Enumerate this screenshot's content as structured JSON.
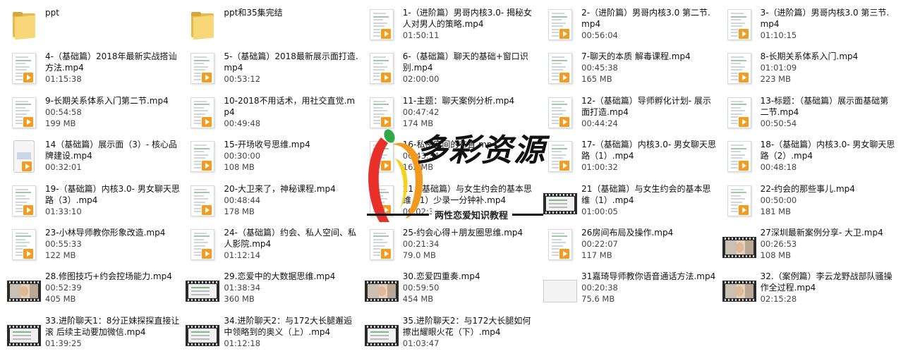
{
  "items": [
    {
      "name": "ppt",
      "line1": "",
      "line2": "",
      "thumb": "folder"
    },
    {
      "name": "ppt和35集完结",
      "line1": "",
      "line2": "",
      "thumb": "folder"
    },
    {
      "name": "1-（进阶篇）男哥内核3.0- 揭秘女人对男人的策略.mp4",
      "line1": "01:50:11",
      "line2": "",
      "thumb": "doc"
    },
    {
      "name": "2-（进阶篇）男哥内核3.0 第二节.mp4",
      "line1": "00:56:04",
      "line2": "",
      "thumb": "doc"
    },
    {
      "name": "3-（进阶篇）男哥内核3.0 第三节.mp4",
      "line1": "01:10:15",
      "line2": "",
      "thumb": "doc"
    },
    {
      "name": "4-（基础篇）2018年最新实战搭讪方法.mp4",
      "line1": "01:15:38",
      "line2": "",
      "thumb": "doc"
    },
    {
      "name": "5-（基础篇）2018最新展示面打造.mp4",
      "line1": "00:53:12",
      "line2": "",
      "thumb": "doc"
    },
    {
      "name": "6-（基础篇）聊天的基础+窗口识别.mp4",
      "line1": "02:00:00",
      "line2": "",
      "thumb": "doc"
    },
    {
      "name": "7-聊天的本质 解毒课程.mp4",
      "line1": "00:45:38",
      "line2": "165 MB",
      "thumb": "doc"
    },
    {
      "name": "8-长期关系体系入门.mp4",
      "line1": "01:01:09",
      "line2": "223 MB",
      "thumb": "doc"
    },
    {
      "name": "9-长期关系体系入门第二节.mp4",
      "line1": "00:54:58",
      "line2": "199 MB",
      "thumb": "doc"
    },
    {
      "name": "10-2018不用话术，用社交直觉.mp4",
      "line1": "00:49:48",
      "line2": "",
      "thumb": "doc"
    },
    {
      "name": "11-主题：聊天案例分析.mp4",
      "line1": "00:47:42",
      "line2": "174 MB",
      "thumb": "doc"
    },
    {
      "name": "12-（基础篇）导师孵化计划- 展示面打造.mp4",
      "line1": "00:44:24",
      "line2": "",
      "thumb": "doc"
    },
    {
      "name": "13-标题：（基础篇）展示面基础第二节.mp4",
      "line1": "00:50:54",
      "line2": "",
      "thumb": "doc"
    },
    {
      "name": "14（基础篇）展示面（3）- 核心品牌建设.mp4",
      "line1": "00:32:01",
      "line2": "",
      "thumb": "phone"
    },
    {
      "name": "15-开场收号思维.mp4",
      "line1": "00:30:00",
      "line2": "108 MB",
      "thumb": "doc"
    },
    {
      "name": "16-私密空间的布置.mp4",
      "line1": "00:43:34",
      "line2": "162 MB",
      "thumb": "doc"
    },
    {
      "name": "17-（基础篇）内核3.0- 男女聊天思路（1）.mp4",
      "line1": "01:00:32",
      "line2": "",
      "thumb": "doc"
    },
    {
      "name": "18-（基础篇）内核3.0- 男女聊天思路（2）.mp4",
      "line1": "00:48:18",
      "line2": "",
      "thumb": "doc"
    },
    {
      "name": "19-（基础篇）内核3.0- 男女聊天思路（3）.mp4",
      "line1": "01:33:10",
      "line2": "",
      "thumb": "doc"
    },
    {
      "name": "20-大卫来了，神秘课程.mp4",
      "line1": "00:48:44",
      "line2": "178 MB",
      "thumb": "doc"
    },
    {
      "name": "21（基础篇）与女生约会的基本思维（1）少录一分钟补.mp4",
      "line1": "00:02:34",
      "line2": "",
      "thumb": "doc"
    },
    {
      "name": "21（基础篇）与女生约会的基本思维（1）.mp4",
      "line1": "01:00:05",
      "line2": "",
      "thumb": "film-screen"
    },
    {
      "name": "22-约会的那些事儿.mp4",
      "line1": "00:50:00",
      "line2": "181 MB",
      "thumb": "doc"
    },
    {
      "name": "23-小林导师教你形象改造.mp4",
      "line1": "00:55:33",
      "line2": "122 MB",
      "thumb": "doc"
    },
    {
      "name": "24-（基础篇）约会、私人空间、私人影院.mp4",
      "line1": "01:12:14",
      "line2": "",
      "thumb": "doc"
    },
    {
      "name": "25-约会心得＋朋友圈思维.mp4",
      "line1": "00:21:34",
      "line2": "79.0 MB",
      "thumb": "doc"
    },
    {
      "name": "26房间布局及操作.mp4",
      "line1": "00:22:07",
      "line2": "117 MB",
      "thumb": "doc"
    },
    {
      "name": "27深圳最新案例分享- 大卫.mp4",
      "line1": "00:26:53",
      "line2": "108 MB",
      "thumb": "film-person"
    },
    {
      "name": "28.修图技巧+约会控场能力.mp4",
      "line1": "00:52:39",
      "line2": "405 MB",
      "thumb": "film-person"
    },
    {
      "name": "29.恋爱中的大数据思维.mp4",
      "line1": "01:38:34",
      "line2": "360 MB",
      "thumb": "film-screen"
    },
    {
      "name": "30.恋爱四重奏.mp4",
      "line1": "00:59:50",
      "line2": "454 MB",
      "thumb": "film-person"
    },
    {
      "name": "31嘉琦导师教你语音通话方法.mp4",
      "line1": "00:20:38",
      "line2": "75.6 MB",
      "thumb": "film-blank"
    },
    {
      "name": "32.（案例篇）李云龙野战部队骚操作全过程.mp4",
      "line1": "02:15:28",
      "line2": "",
      "thumb": "film-person"
    },
    {
      "name": "33.进阶聊天1：8分正妹探探直接让滚 后续主动要加微信.mp4",
      "line1": "01:39:25",
      "line2": "",
      "thumb": "film-screen"
    },
    {
      "name": "34.进阶聊天2：与172大长腿邂逅中领略到的奥义（上）.mp4",
      "line1": "01:12:18",
      "line2": "",
      "thumb": "film-screen"
    },
    {
      "name": "35.进阶聊天2：与172大长腿如何擦出耀眼火花（下）.mp4",
      "line1": "01:03:47",
      "line2": "",
      "thumb": "film-screen"
    }
  ],
  "watermark": {
    "title": "多彩资源",
    "subtitle": "两性恋爱知识教程",
    "colors": {
      "orange": "#f39a1e",
      "red": "#e8302a",
      "yellow": "#f6d21f",
      "green": "#2fa84a"
    }
  }
}
